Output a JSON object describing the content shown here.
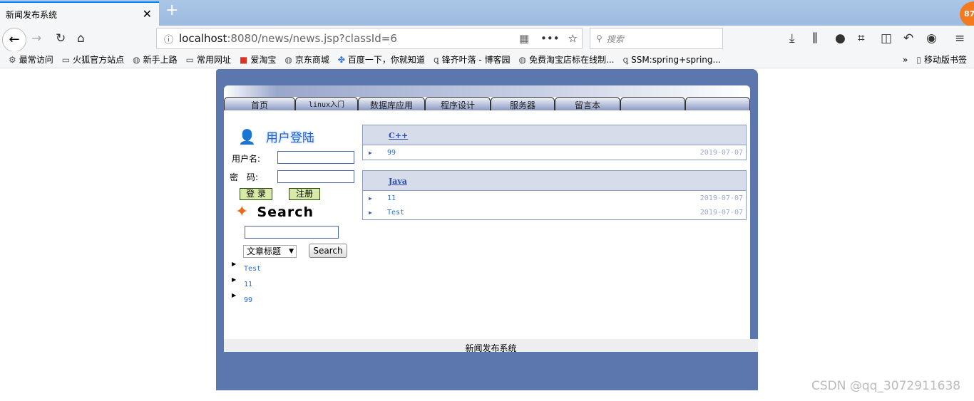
{
  "browser": {
    "tab_title": "新闻发布系统",
    "url_host": "localhost",
    "url_rest": ":8080/news/news.jsp?classId=6",
    "search_placeholder": "搜索",
    "badge": "87",
    "bookmarks": [
      {
        "icon": "gear-icon",
        "label": "最常访问"
      },
      {
        "icon": "folder-icon",
        "label": "火狐官方站点"
      },
      {
        "icon": "globe-icon",
        "label": "新手上路"
      },
      {
        "icon": "folder-icon",
        "label": "常用网址"
      },
      {
        "icon": "taobao-icon",
        "label": "爱淘宝"
      },
      {
        "icon": "globe-icon",
        "label": "京东商城"
      },
      {
        "icon": "baidu-icon",
        "label": "百度一下，你就知道"
      },
      {
        "icon": "cnblogs-icon",
        "label": "锋齐叶落 - 博客园"
      },
      {
        "icon": "globe-icon",
        "label": "免费淘宝店标在线制..."
      },
      {
        "icon": "cnblogs-icon",
        "label": "SSM:spring+spring..."
      }
    ],
    "mobile_bookmarks": "移动版书签"
  },
  "nav": [
    "首页",
    "linux入门",
    "数据库应用",
    "程序设计",
    "服务器",
    "留言本",
    "",
    ""
  ],
  "login": {
    "title": "用户登陆",
    "username_label": "用户名:",
    "password_label": "密　码:",
    "login_btn": "登 录",
    "register_btn": "注册"
  },
  "search": {
    "title": "Search",
    "select_value": "文章标题",
    "button": "Search",
    "results": [
      "Test",
      "11",
      "99"
    ]
  },
  "categories": [
    {
      "name": "C++",
      "items": [
        {
          "title": "99",
          "date": "2019-07-07"
        }
      ]
    },
    {
      "name": "Java",
      "items": [
        {
          "title": "11",
          "date": "2019-07-07"
        },
        {
          "title": "Test",
          "date": "2019-07-07"
        }
      ]
    }
  ],
  "footer": "新闻发布系统",
  "watermark": "CSDN @qq_3072911638"
}
